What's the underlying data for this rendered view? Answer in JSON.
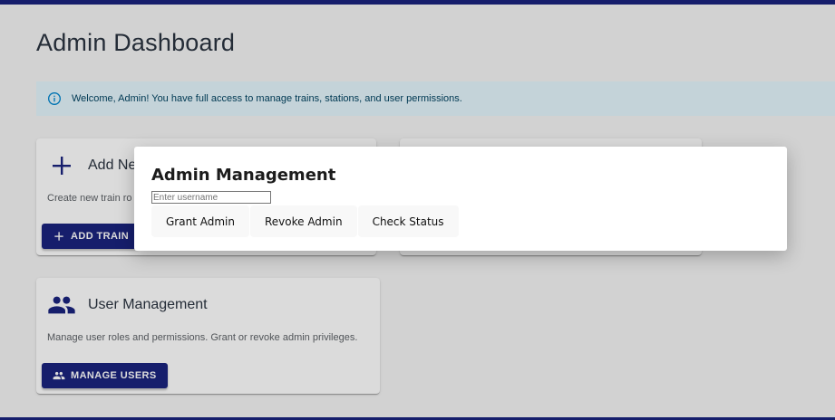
{
  "page": {
    "title": "Admin Dashboard",
    "alert": "Welcome, Admin! You have full access to manage trains, stations, and user permissions."
  },
  "cards": {
    "train": {
      "title": "Add Ne",
      "description": "Create new train ro",
      "button": "ADD TRAIN",
      "icon": "plus-icon"
    },
    "user": {
      "title": "User Management",
      "description": "Manage user roles and permissions. Grant or revoke admin privileges.",
      "button": "MANAGE USERS",
      "icon": "people-icon"
    }
  },
  "modal": {
    "title": "Admin Management",
    "input_placeholder": "Enter username",
    "input_value": "",
    "buttons": [
      "Grant Admin",
      "Revoke Admin",
      "Check Status"
    ]
  },
  "colors": {
    "primary": "#1a237e",
    "alert_bg": "#e5f6fd",
    "alert_text": "#014361",
    "alert_icon": "#0288d1"
  }
}
